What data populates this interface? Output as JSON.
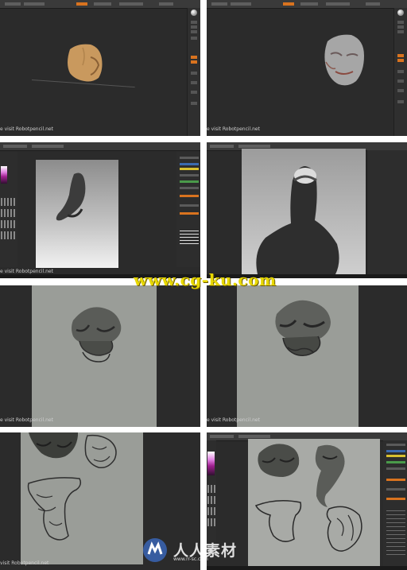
{
  "watermark_text": "e visit Robotpencil.net",
  "watermark_text_short": "visit Robotpencil.net",
  "site_watermark": "www.cg-ku.com",
  "logo_watermark": {
    "title": "人人素材",
    "subtitle": "www.rr-sc.com"
  },
  "colors": {
    "ui_dark": "#2b2b2b",
    "accent_orange": "#d9731f",
    "canvas_gray": "#9a9d98",
    "watermark_yellow": "#e8d800"
  },
  "panels": [
    {
      "id": "zbrush-clay-head",
      "icon": "sculpt-head"
    },
    {
      "id": "zbrush-gray-head",
      "icon": "sculpt-head"
    },
    {
      "id": "photoshop-ink-blob",
      "icon": "ink-sketch"
    },
    {
      "id": "photoshop-ink-bust",
      "icon": "ink-bust"
    },
    {
      "id": "gray-canvas-sketch-1",
      "icon": "creature-sketch"
    },
    {
      "id": "gray-canvas-sketch-2",
      "icon": "creature-sketch"
    },
    {
      "id": "gray-canvas-sketch-sheet",
      "icon": "sketch-sheet"
    },
    {
      "id": "photoshop-sketch-sheet",
      "icon": "sketch-sheet"
    }
  ]
}
